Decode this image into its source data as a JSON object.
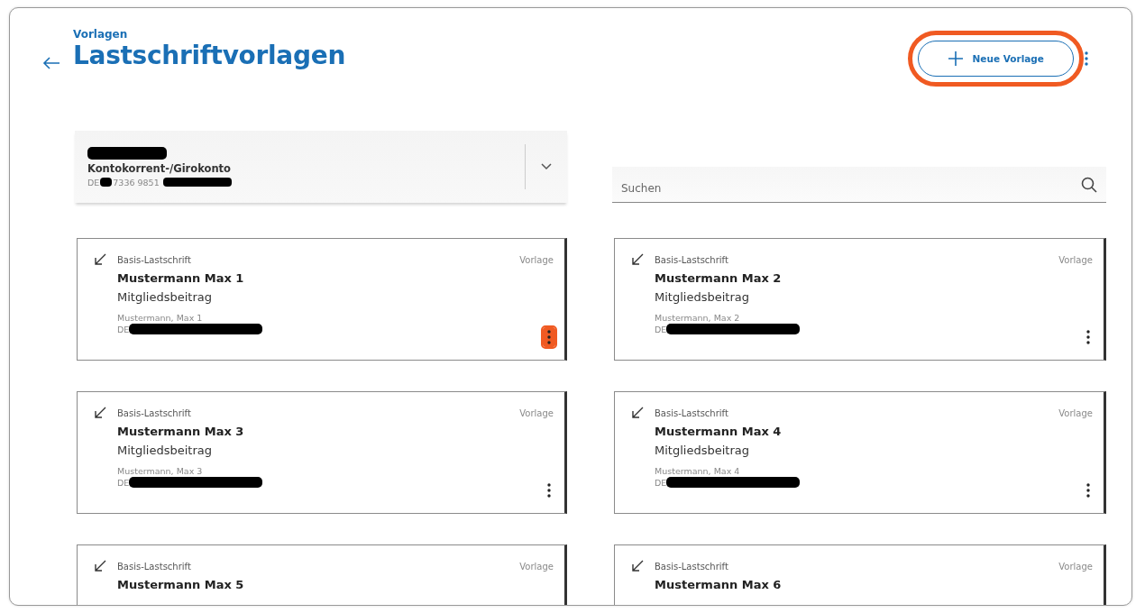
{
  "header": {
    "breadcrumb": "Vorlagen",
    "title": "Lastschriftvorlagen",
    "new_button": {
      "label": "Neue Vorlage",
      "highlighted": true
    }
  },
  "account": {
    "type": "Kontokorrent-/Girokonto",
    "iban_prefix": "DE",
    "iban_visible": "7336 9851"
  },
  "search": {
    "placeholder": "Suchen"
  },
  "cards": [
    {
      "type": "Basis-Lastschrift",
      "status": "Vorlage",
      "name": "Mustermann Max 1",
      "purpose": "Mitgliedsbeitrag",
      "payer": "Mustermann, Max 1",
      "iban_prefix": "DE",
      "menu_highlighted": true
    },
    {
      "type": "Basis-Lastschrift",
      "status": "Vorlage",
      "name": "Mustermann Max 2",
      "purpose": "Mitgliedsbeitrag",
      "payer": "Mustermann, Max 2",
      "iban_prefix": "DE",
      "menu_highlighted": false
    },
    {
      "type": "Basis-Lastschrift",
      "status": "Vorlage",
      "name": "Mustermann Max 3",
      "purpose": "Mitgliedsbeitrag",
      "payer": "Mustermann, Max 3",
      "iban_prefix": "DE",
      "menu_highlighted": false
    },
    {
      "type": "Basis-Lastschrift",
      "status": "Vorlage",
      "name": "Mustermann Max 4",
      "purpose": "Mitgliedsbeitrag",
      "payer": "Mustermann, Max 4",
      "iban_prefix": "DE",
      "menu_highlighted": false
    },
    {
      "type": "Basis-Lastschrift",
      "status": "Vorlage",
      "name": "Mustermann Max 5"
    },
    {
      "type": "Basis-Lastschrift",
      "status": "Vorlage",
      "name": "Mustermann Max 6"
    }
  ]
}
